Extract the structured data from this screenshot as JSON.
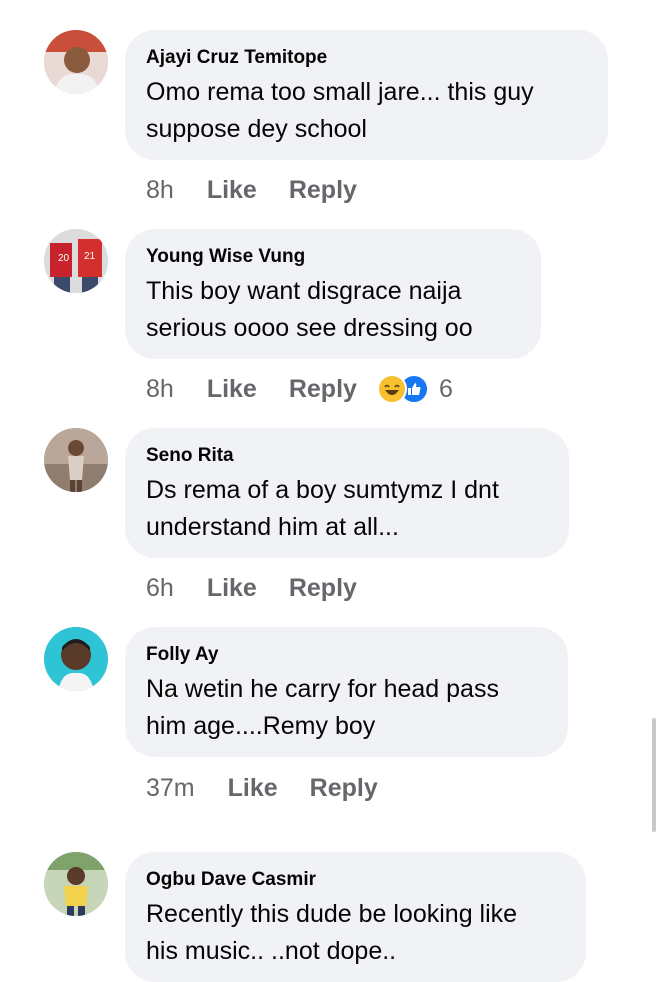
{
  "comments": [
    {
      "author": "Ajayi Cruz Temitope",
      "text": "Omo rema too small jare... this guy\nsuppose dey school",
      "time": "8h",
      "like_label": "Like",
      "reply_label": "Reply"
    },
    {
      "author": "Young Wise Vung",
      "text": "This boy want disgrace naija\nserious oooo see dressing oo",
      "time": "8h",
      "like_label": "Like",
      "reply_label": "Reply",
      "reactions": {
        "icons": [
          "haha-reaction-icon",
          "like-reaction-icon"
        ],
        "count": "6"
      }
    },
    {
      "author": "Seno Rita",
      "text": "Ds rema of a boy sumtymz I dnt\nunderstand him at all...",
      "time": "6h",
      "like_label": "Like",
      "reply_label": "Reply"
    },
    {
      "author": "Folly Ay",
      "text": "Na wetin he carry for head pass\nhim age....Remy boy",
      "time": "37m",
      "like_label": "Like",
      "reply_label": "Reply"
    },
    {
      "author": "Ogbu Dave Casmir",
      "text": "Recently this dude be looking like\nhis music.. ..not dope.."
    }
  ],
  "colors": {
    "bubble_background": "#f0f2f5",
    "meta_text": "#65676b",
    "like_reaction": "#1877f2",
    "haha_reaction": "#f7c02f"
  }
}
